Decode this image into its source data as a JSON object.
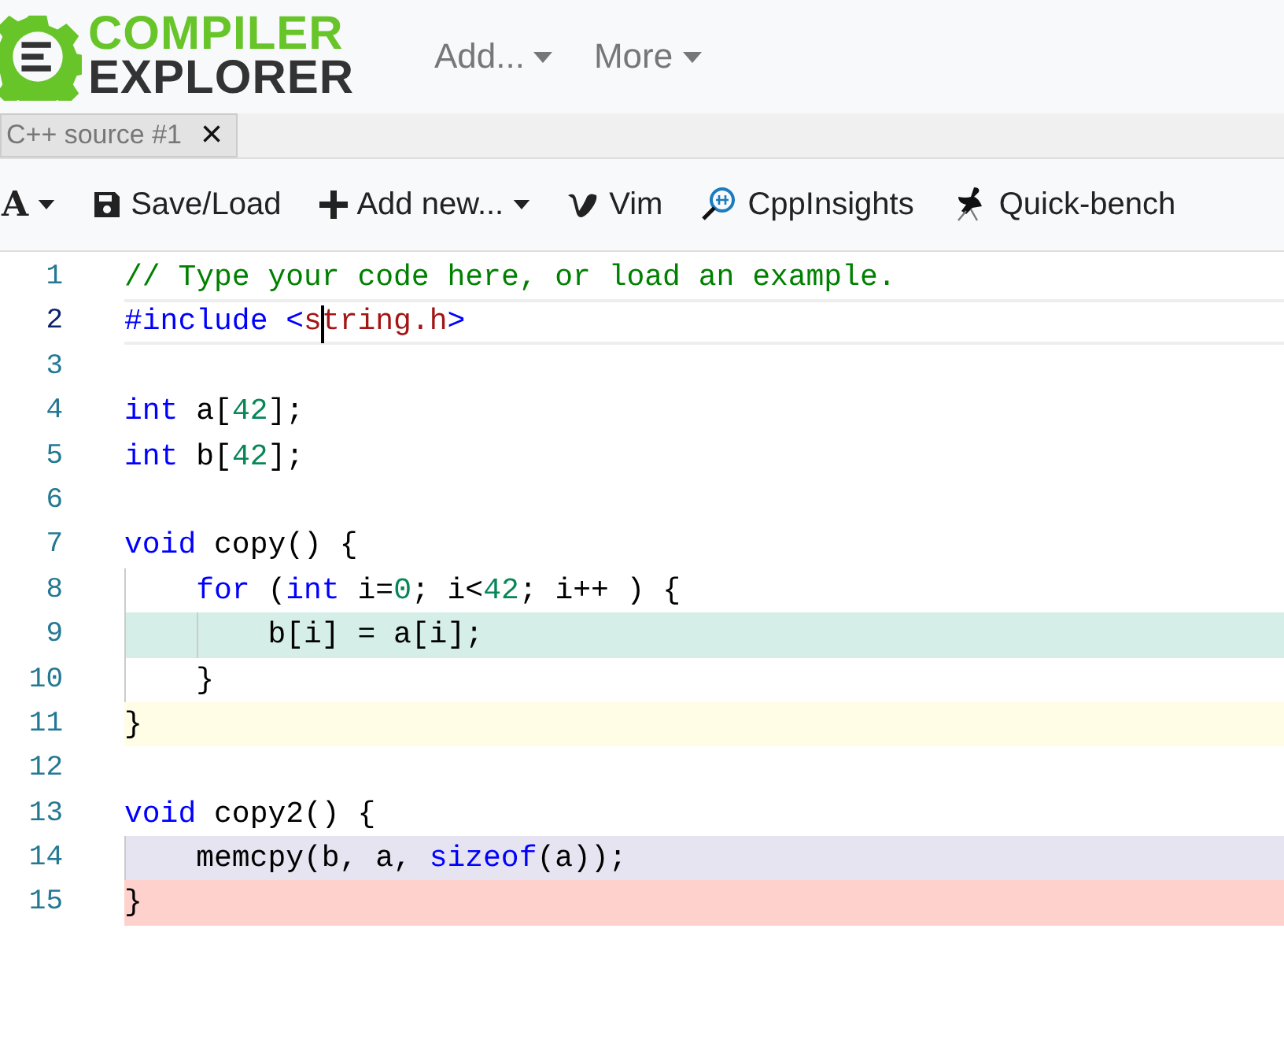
{
  "logo": {
    "line_1": "COMPILER",
    "line_2": "EXPLORER"
  },
  "nav": [
    {
      "label": "Add..."
    },
    {
      "label": "More"
    }
  ],
  "tabs": [
    {
      "label": "C++ source #1",
      "close": "×",
      "selected": true
    }
  ],
  "toolbar": [
    {
      "kind": "font",
      "label": "A"
    },
    {
      "kind": "save",
      "label": "Save/Load"
    },
    {
      "kind": "add",
      "label": "Add new..."
    },
    {
      "kind": "vim",
      "label": "Vim"
    },
    {
      "kind": "insights",
      "label": "CppInsights"
    },
    {
      "kind": "bench",
      "label": "Quick-bench"
    }
  ],
  "lines": [
    {
      "number": "1",
      "current": false,
      "tokens": [
        {
          "kind": "comment",
          "text": "// Type your code here, or load an example."
        }
      ]
    },
    {
      "number": "2",
      "current": true,
      "tokens": [
        {
          "kind": "preproc",
          "text": "#include "
        },
        {
          "kind": "preproc",
          "text": "<"
        },
        {
          "kind": "string",
          "text": "s",
          "caret": true
        },
        {
          "kind": "string",
          "text": "tring.h"
        },
        {
          "kind": "preproc",
          "text": ">"
        }
      ]
    },
    {
      "number": "3",
      "current": false
    },
    {
      "number": "4",
      "current": false,
      "tokens": [
        {
          "kind": "keyword",
          "text": "int"
        },
        {
          "kind": "plain",
          "text": " a["
        },
        {
          "kind": "number",
          "text": "42"
        },
        {
          "kind": "plain",
          "text": "];"
        }
      ]
    },
    {
      "number": "5",
      "current": false,
      "tokens": [
        {
          "kind": "keyword",
          "text": "int"
        },
        {
          "kind": "plain",
          "text": " b["
        },
        {
          "kind": "number",
          "text": "42"
        },
        {
          "kind": "plain",
          "text": "];"
        }
      ]
    },
    {
      "number": "6",
      "current": false
    },
    {
      "number": "7",
      "current": false,
      "tokens": [
        {
          "kind": "keyword",
          "text": "void"
        },
        {
          "kind": "plain",
          "text": " copy() {"
        }
      ]
    },
    {
      "number": "8",
      "current": false,
      "tokens": [
        {
          "kind": "indent"
        },
        {
          "kind": "keyword",
          "text": "for"
        },
        {
          "kind": "plain",
          "text": " ("
        },
        {
          "kind": "keyword",
          "text": "int"
        },
        {
          "kind": "plain",
          "text": " i="
        },
        {
          "kind": "number",
          "text": "0"
        },
        {
          "kind": "plain",
          "text": "; i<"
        },
        {
          "kind": "number",
          "text": "42"
        },
        {
          "kind": "plain",
          "text": "; i++ ) {"
        }
      ]
    },
    {
      "number": "9",
      "current": false,
      "color": "#d5eee8",
      "tokens": [
        {
          "kind": "indent"
        },
        {
          "kind": "indent"
        },
        {
          "kind": "plain",
          "text": "b[i] = a[i];"
        }
      ]
    },
    {
      "number": "10",
      "current": false,
      "tokens": [
        {
          "kind": "indent"
        },
        {
          "kind": "plain",
          "text": "}"
        }
      ]
    },
    {
      "number": "11",
      "current": false,
      "color": "#fffde6",
      "tokens": [
        {
          "kind": "plain",
          "text": "}"
        }
      ]
    },
    {
      "number": "12",
      "current": false
    },
    {
      "number": "13",
      "current": false,
      "tokens": [
        {
          "kind": "keyword",
          "text": "void"
        },
        {
          "kind": "plain",
          "text": " copy2() {"
        }
      ]
    },
    {
      "number": "14",
      "current": false,
      "color": "#e6e4f0",
      "tokens": [
        {
          "kind": "indent"
        },
        {
          "kind": "plain",
          "text": "memcpy(b, a, "
        },
        {
          "kind": "keyword",
          "text": "sizeof"
        },
        {
          "kind": "plain",
          "text": "(a));"
        }
      ]
    },
    {
      "number": "15",
      "current": false,
      "color": "#ffd1cc",
      "tokens": [
        {
          "kind": "plain",
          "text": "}"
        }
      ]
    }
  ]
}
